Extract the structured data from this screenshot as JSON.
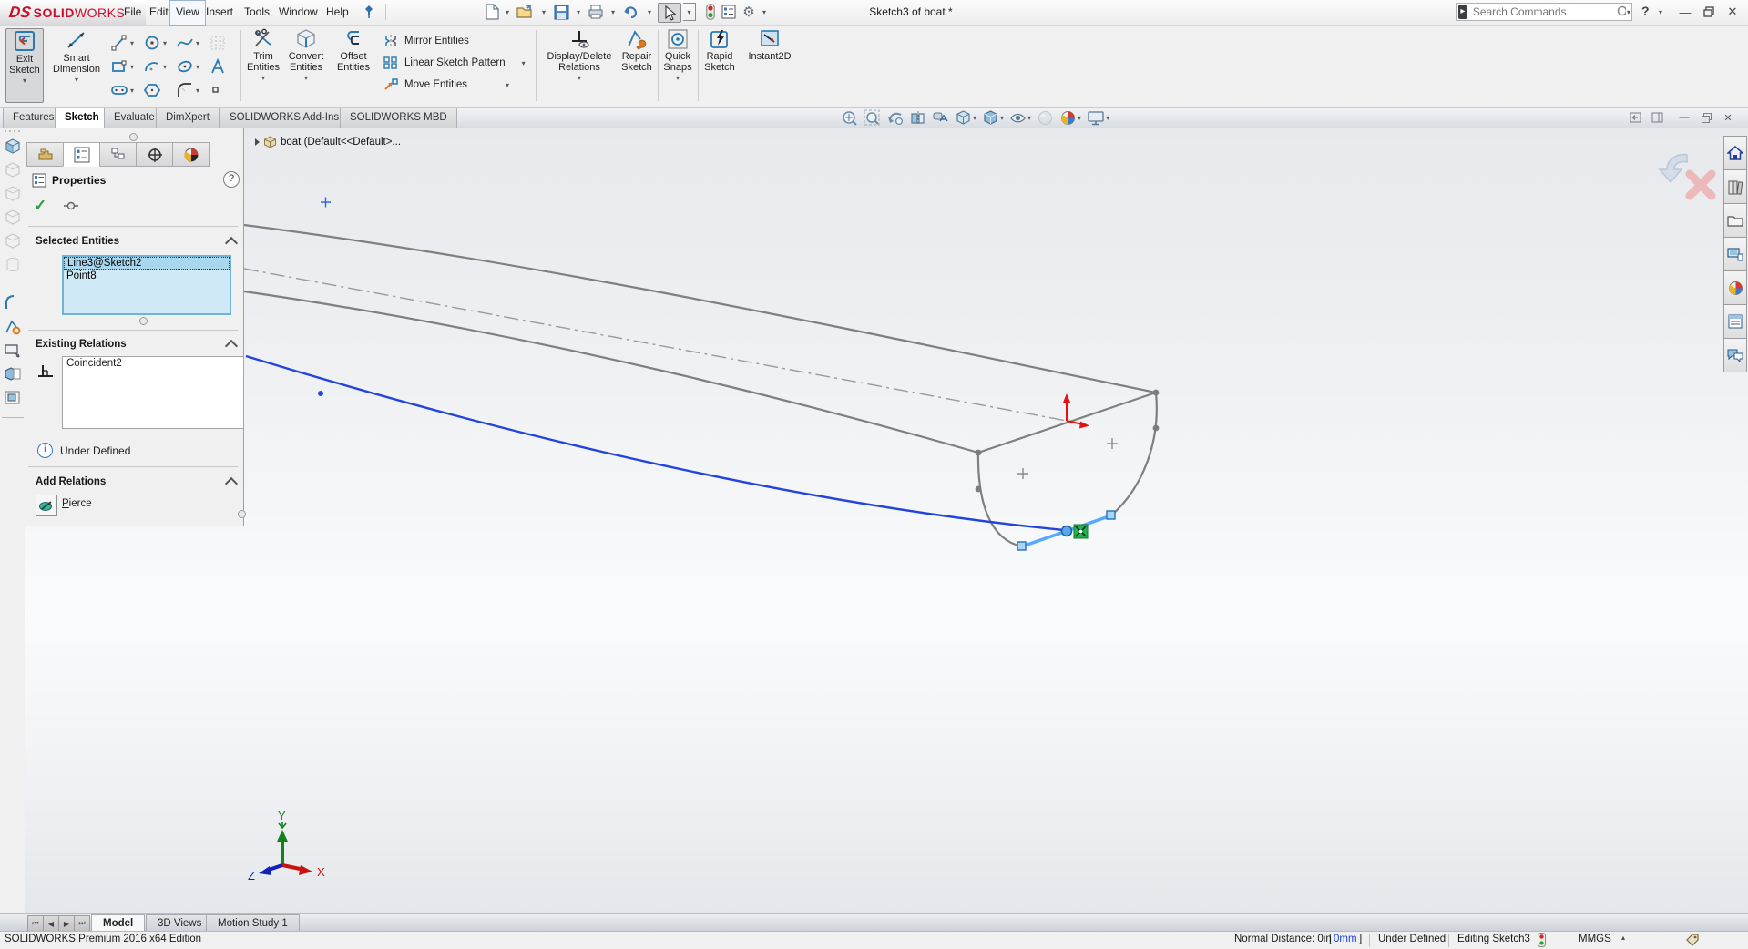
{
  "title_bar": {
    "logo": {
      "mark": "DS",
      "bold": "SOLID",
      "light": "WORKS"
    },
    "menus": [
      "File",
      "Edit",
      "View",
      "Insert",
      "Tools",
      "Window",
      "Help"
    ],
    "document_title": "Sketch3 of boat *",
    "search": {
      "placeholder": "Search Commands"
    },
    "help_label": "?"
  },
  "ribbon": {
    "exit_sketch": "Exit\nSketch",
    "smart_dimension": "Smart\nDimension",
    "trim_entities": "Trim\nEntities",
    "convert_entities": "Convert\nEntities",
    "offset_entities": "Offset\nEntities",
    "mirror_entities": "Mirror Entities",
    "linear_sketch_pattern": "Linear Sketch Pattern",
    "move_entities": "Move Entities",
    "display_delete_relations": "Display/Delete\nRelations",
    "repair_sketch": "Repair\nSketch",
    "quick_snaps": "Quick\nSnaps",
    "rapid_sketch": "Rapid\nSketch",
    "instant2d": "Instant2D"
  },
  "command_tabs": [
    "Features",
    "Sketch",
    "Evaluate",
    "DimXpert",
    "SOLIDWORKS Add-Ins",
    "SOLIDWORKS MBD"
  ],
  "property_panel": {
    "title": "Properties",
    "help": "?",
    "groups": {
      "selected_entities": {
        "title": "Selected Entities",
        "items": [
          "Line3@Sketch2",
          "Point8"
        ]
      },
      "existing_relations": {
        "title": "Existing Relations",
        "items": [
          "Coincident2"
        ]
      },
      "add_relations": {
        "title": "Add Relations",
        "pierce": "Pierce"
      }
    },
    "status": "Under Defined"
  },
  "viewport": {
    "tree_item": "boat (Default<<Default>...",
    "triad": {
      "x": "X",
      "y": "Y",
      "z": "Z"
    }
  },
  "document_tabs": [
    "Model",
    "3D Views",
    "Motion Study 1"
  ],
  "status_bar": {
    "edition": "SOLIDWORKS Premium 2016 x64 Edition",
    "normal_distance": "Normal Distance: 0in",
    "mm_open": "[",
    "mm_value": "0mm",
    "mm_close": "]",
    "define_state": "Under Defined",
    "editing": "Editing Sketch3",
    "units": "MMGS"
  },
  "colors": {
    "accent_blue": "#2a7ab0",
    "selection_blue": "#55aaff",
    "sketch_blue": "#2244dd",
    "logo_red": "#c8102e",
    "relation_green": "#22b14c",
    "origin_red": "#e81010"
  }
}
